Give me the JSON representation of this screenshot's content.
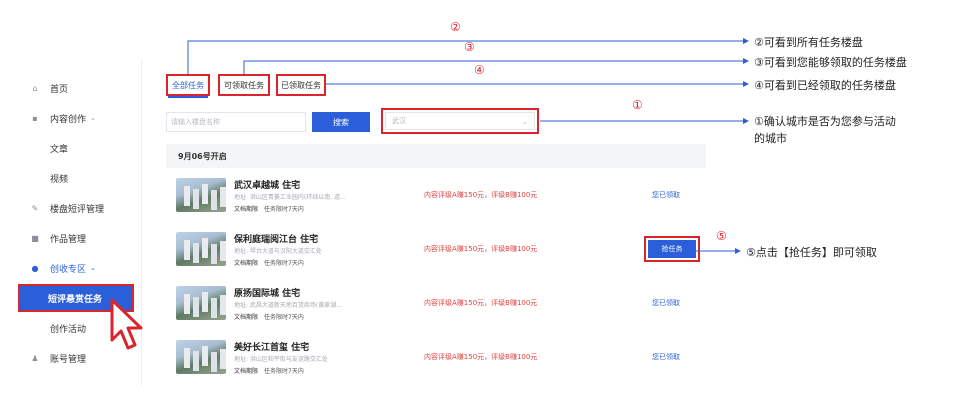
{
  "sidebar": {
    "items": [
      {
        "label": "首页",
        "icon": "home-icon"
      },
      {
        "label": "内容创作",
        "icon": "document-icon",
        "caret": "⌄"
      },
      {
        "label": "文章"
      },
      {
        "label": "视频"
      },
      {
        "label": "楼盘短评管理",
        "icon": "edit-icon"
      },
      {
        "label": "作品管理",
        "icon": "folder-icon"
      },
      {
        "label": "创收专区",
        "icon": "coin-icon",
        "caret": "⌄"
      },
      {
        "label": "短评悬赏任务"
      },
      {
        "label": "创作活动"
      },
      {
        "label": "账号管理",
        "icon": "user-icon"
      }
    ]
  },
  "tabs": {
    "all": "全部任务",
    "can_claim": "可领取任务",
    "claimed": "已领取任务"
  },
  "search": {
    "placeholder": "请输入楼盘名称",
    "button": "搜索",
    "city": "武汉"
  },
  "date_header": "9月06号开启",
  "tasks": [
    {
      "title": "武汉卓越城  住宅",
      "address": "地址: 洪山区青菱工业园内(环线以南, 道...",
      "tag": "文档期限",
      "period": "任务限时7天内",
      "reward": "内容评级A赚150元，评级B赚100元",
      "action": "您已领取"
    },
    {
      "title": "保利庭瑞阅江台  住宅",
      "address": "地址: 琴台大道与汉阳大道交汇处",
      "tag": "文档期限",
      "period": "任务限时7天内",
      "reward": "内容评级A赚150元，评级B赚100元",
      "action": "抢任务"
    },
    {
      "title": "原扬国际城  住宅",
      "address": "地址: 武昌大道新天地百货商场(黄家湖...",
      "tag": "文档期限",
      "period": "任务限时7天内",
      "reward": "内容评级A赚150元，评级B赚100元",
      "action": "您已领取"
    },
    {
      "title": "美好长江首玺  住宅",
      "address": "地址: 洪山区和平街与友谊路交汇处",
      "tag": "文档期限",
      "period": "任务限时7天内",
      "reward": "内容评级A赚150元，评级B赚100元",
      "action": "您已领取"
    }
  ],
  "annotations": {
    "n1": "①",
    "n2": "②",
    "n3": "③",
    "n4": "④",
    "n5": "⑤",
    "note2": "②可看到所有任务楼盘",
    "note3": "③可看到您能够领取的任务楼盘",
    "note4": "④可看到已经领取的任务楼盘",
    "note1_line1": "①确认城市是否为您参与活动",
    "note1_line2": "的城市",
    "note5": "⑤点击【抢任务】即可领取"
  },
  "colors": {
    "accent": "#2b5fd9",
    "highlight": "#d9262c",
    "reward": "#e0413f"
  }
}
